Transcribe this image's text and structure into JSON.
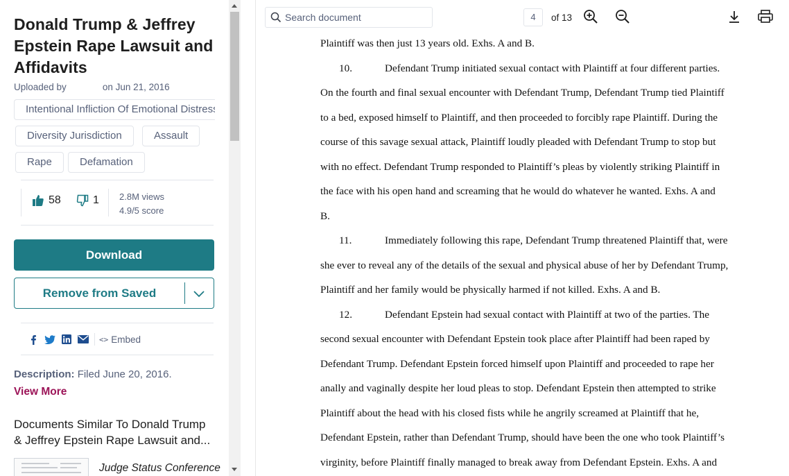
{
  "document": {
    "title": "Donald Trump & Jeffrey Epstein Rape Lawsuit and Affidavits",
    "uploaded_by_label": "Uploaded by",
    "uploaded_date": "on Jun 21, 2016",
    "tags": [
      "Intentional Infliction Of Emotional Distress",
      "Diversity Jurisdiction",
      "Assault",
      "Rape",
      "Defamation"
    ]
  },
  "stats": {
    "likes": "58",
    "dislikes": "1",
    "views": "2.8M views",
    "score": "4.9/5 score"
  },
  "actions": {
    "download_label": "Download",
    "saved_label": "Remove from Saved",
    "embed_label": "Embed",
    "embed_code_glyph": "<>"
  },
  "description": {
    "label": "Description:",
    "text": "Filed June 20, 2016.",
    "view_more": "View More"
  },
  "similar": {
    "heading": "Documents Similar To Donald Trump & Jeffrey Epstein Rape Lawsuit and...",
    "first_item": "Judge Status Conference"
  },
  "toolbar": {
    "search_placeholder": "Search document",
    "current_page": "4",
    "total_pages": "of 13"
  },
  "page_lines": [
    {
      "num": "",
      "text": "Plaintiff was then just 13 years old.  Exhs. A and B."
    },
    {
      "num": "10.",
      "text": "Defendant Trump initiated sexual contact with Plaintiff at four different parties."
    },
    {
      "num": "",
      "text": "On the fourth and final sexual encounter with Defendant Trump, Defendant Trump tied Plaintiff"
    },
    {
      "num": "",
      "text": "to a bed, exposed himself to Plaintiff, and then proceeded to forcibly rape Plaintiff.  During the"
    },
    {
      "num": "",
      "text": "course of this savage sexual attack, Plaintiff loudly pleaded with Defendant Trump to stop but"
    },
    {
      "num": "",
      "text": "with no effect.  Defendant Trump responded to Plaintiff’s pleas by violently striking Plaintiff in"
    },
    {
      "num": "",
      "text": "the face with his open hand and screaming that he would do whatever he wanted.  Exhs. A and"
    },
    {
      "num": "",
      "text": "B."
    },
    {
      "num": "11.",
      "text": "Immediately following this rape, Defendant Trump threatened Plaintiff that, were"
    },
    {
      "num": "",
      "text": "she ever to reveal any of the details of the sexual and physical abuse of her by Defendant Trump,"
    },
    {
      "num": "",
      "text": "Plaintiff and her family would be physically harmed if not killed.  Exhs. A and B."
    },
    {
      "num": "12.",
      "text": "Defendant Epstein had sexual contact with Plaintiff at two of the parties.  The"
    },
    {
      "num": "",
      "text": "second sexual encounter with Defendant Epstein took place after Plaintiff had been raped by"
    },
    {
      "num": "",
      "text": "Defendant Trump.  Defendant Epstein forced himself upon Plaintiff and proceeded to rape her"
    },
    {
      "num": "",
      "text": "anally and vaginally despite her loud pleas to stop.  Defendant Epstein then attempted to strike"
    },
    {
      "num": "",
      "text": "Plaintiff about the head with his closed fists while he angrily screamed at Plaintiff that he,"
    },
    {
      "num": "",
      "text": "Defendant Epstein, rather than Defendant Trump, should have been the one who took Plaintiff’s"
    },
    {
      "num": "",
      "text": "virginity, before Plaintiff finally managed to break away from Defendant Epstein.  Exhs. A and"
    }
  ],
  "icons": {
    "like": "thumbs-up-icon",
    "dislike": "thumbs-down-icon",
    "facebook": "facebook-icon",
    "twitter": "twitter-icon",
    "linkedin": "linkedin-icon",
    "email": "email-icon",
    "search": "search-icon",
    "zoom_in": "zoom-in-icon",
    "zoom_out": "zoom-out-icon",
    "download": "download-icon",
    "print": "print-icon"
  },
  "colors": {
    "accent": "#1e7b85",
    "view_more": "#9c1458",
    "muted_text": "#57617a"
  }
}
